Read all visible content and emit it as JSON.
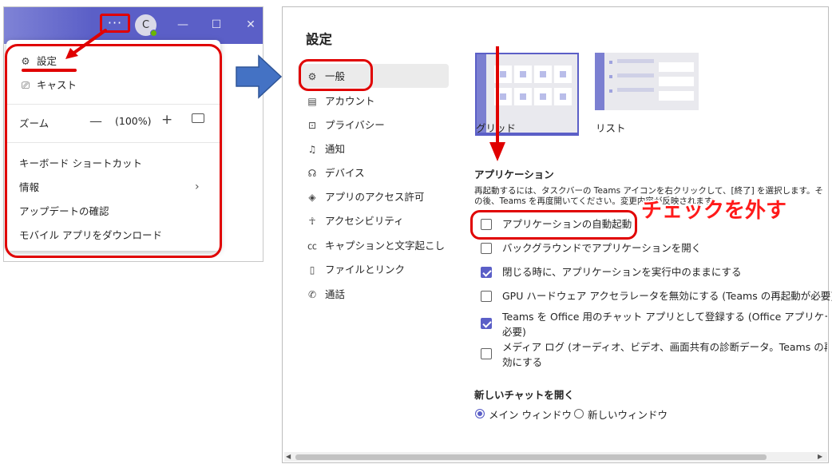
{
  "left_panel": {
    "more_label": "···",
    "avatar_initial": "C",
    "window_controls": {
      "minimize": "—",
      "maximize": "☐",
      "close": "✕"
    },
    "menu": {
      "settings": "設定",
      "cast": "キャスト",
      "zoom_label": "ズーム",
      "zoom_minus": "—",
      "zoom_value": "(100%)",
      "zoom_plus": "+",
      "keyboard_shortcuts": "キーボード ショートカット",
      "info": "情報",
      "info_chevron": "›",
      "check_updates": "アップデートの確認",
      "download_mobile": "モバイル アプリをダウンロード"
    }
  },
  "settings": {
    "title": "設定",
    "nav": {
      "general": "一般",
      "accounts": "アカウント",
      "privacy": "プライバシー",
      "notifications": "通知",
      "devices": "デバイス",
      "app_permissions": "アプリのアクセス許可",
      "accessibility": "アクセシビリティ",
      "captions": "キャプションと文字起こし",
      "files": "ファイルとリンク",
      "calls": "通話"
    },
    "layout": {
      "grid_label": "グリッド",
      "list_label": "リスト"
    },
    "applications": {
      "heading": "アプリケーション",
      "description": "再起動するには、タスクバーの Teams アイコンを右クリックして、[終了] を選択します。その後、Teams を再度開いてください。変更内容が反映されます。",
      "options": [
        {
          "label": "アプリケーションの自動起動",
          "checked": false
        },
        {
          "label": "バックグラウンドでアプリケーションを開く",
          "checked": false
        },
        {
          "label": "閉じる時に、アプリケーションを実行中のままにする",
          "checked": true
        },
        {
          "label": "GPU ハードウェア アクセラレータを無効にする (Teams の再起動が必要)",
          "checked": false
        },
        {
          "label": "Teams を Office 用のチャット アプリとして登録する (Office アプリケーションの再起動が",
          "label_line2": "必要)",
          "checked": true
        },
        {
          "label": "メディア ログ (オーディオ、ビデオ、画面共有の診断データ。Teams の再起動が必要) を有",
          "label_line2": "効にする",
          "checked": false
        }
      ]
    },
    "new_chat": {
      "heading": "新しいチャットを開く",
      "options": [
        {
          "label": "メイン ウィンドウ",
          "selected": true
        },
        {
          "label": "新しいウィンドウ",
          "selected": false
        }
      ]
    }
  },
  "annotations": {
    "uncheck_note": "チェックを外す"
  },
  "colors": {
    "accent": "#5b5fc7",
    "annotation_red": "#e00000",
    "arrow_blue": "#4472c4"
  }
}
